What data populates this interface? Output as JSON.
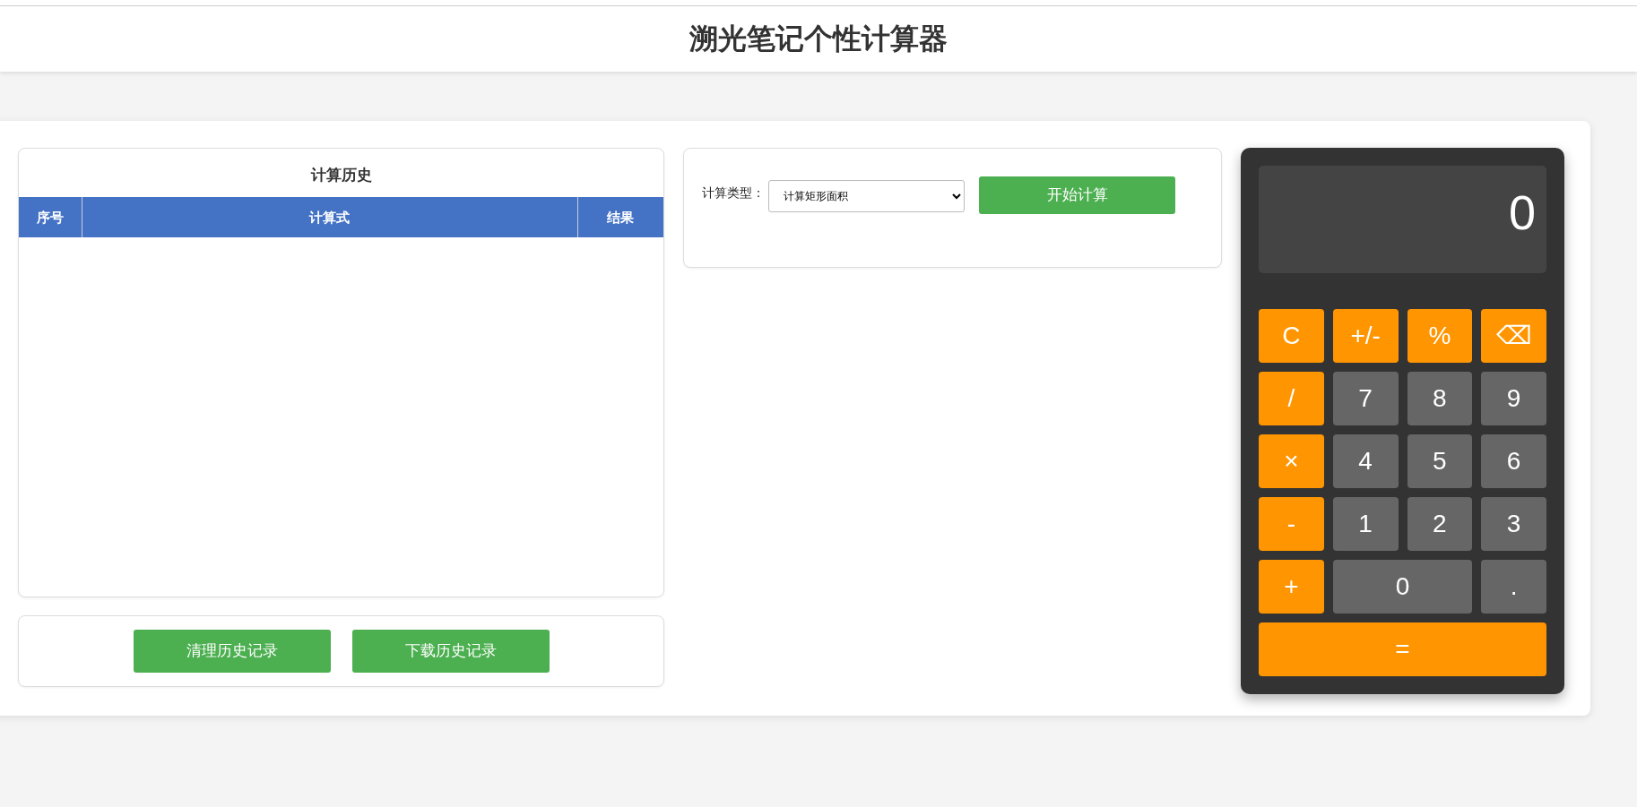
{
  "header": {
    "title": "溯光笔记个性计算器"
  },
  "history": {
    "title": "计算历史",
    "columns": [
      "序号",
      "计算式",
      "结果"
    ]
  },
  "history_buttons": [
    "清理历史记录",
    "下载历史记录"
  ],
  "calc_form": {
    "label": "计算类型：",
    "value": "计算矩形面积",
    "button": "开始计算"
  },
  "calculator": {
    "display": "0",
    "keys": [
      {
        "label": "C",
        "kind": "operator"
      },
      {
        "label": "+/-",
        "kind": "operator"
      },
      {
        "label": "%",
        "kind": "operator"
      },
      {
        "label": "⌫",
        "kind": "operator"
      },
      {
        "label": "/",
        "kind": "operator"
      },
      {
        "label": "7",
        "kind": "digit"
      },
      {
        "label": "8",
        "kind": "digit"
      },
      {
        "label": "9",
        "kind": "digit"
      },
      {
        "label": "×",
        "kind": "operator"
      },
      {
        "label": "4",
        "kind": "digit"
      },
      {
        "label": "5",
        "kind": "digit"
      },
      {
        "label": "6",
        "kind": "digit"
      },
      {
        "label": "-",
        "kind": "operator"
      },
      {
        "label": "1",
        "kind": "digit"
      },
      {
        "label": "2",
        "kind": "digit"
      },
      {
        "label": "3",
        "kind": "digit"
      },
      {
        "label": "+",
        "kind": "operator"
      },
      {
        "label": "0",
        "kind": "wide_digit"
      },
      {
        "label": ".",
        "kind": "digit"
      },
      {
        "label": "=",
        "kind": "wide_operator"
      }
    ]
  }
}
